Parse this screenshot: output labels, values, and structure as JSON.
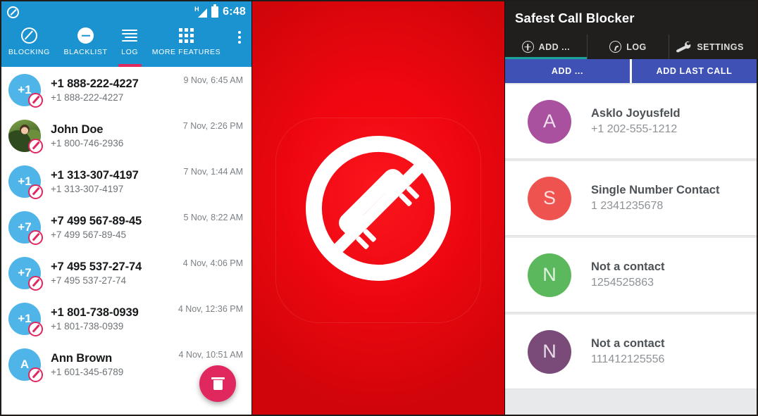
{
  "left_app": {
    "statusbar": {
      "notification_icon": "block-circle-icon",
      "network_type": "H",
      "signal_icon": "signal-bars-icon",
      "battery_icon": "battery-full-icon",
      "time": "6:48"
    },
    "accent_color": "#1b93d1",
    "indicator_color": "#e0275e",
    "tabs": [
      {
        "label": "BLOCKING",
        "icon": "block-circle-icon",
        "active": false
      },
      {
        "label": "BLACKLIST",
        "icon": "minus-circle-icon",
        "active": false
      },
      {
        "label": "LOG",
        "icon": "list-lines-icon",
        "active": true
      },
      {
        "label": "MORE FEATURES",
        "icon": "grid-dots-icon",
        "active": false
      }
    ],
    "overflow_menu": "more-vert-icon",
    "call_log": [
      {
        "title": "+1 888-222-4227",
        "subtitle": "+1 888-222-4227",
        "time": "9 Nov, 6:45 AM",
        "avatar_text": "+1",
        "avatar_type": "initials"
      },
      {
        "title": "John Doe",
        "subtitle": "+1 800-746-2936",
        "time": "7 Nov, 2:26 PM",
        "avatar_text": "",
        "avatar_type": "photo"
      },
      {
        "title": "+1 313-307-4197",
        "subtitle": "+1 313-307-4197",
        "time": "7 Nov, 1:44 AM",
        "avatar_text": "+1",
        "avatar_type": "initials"
      },
      {
        "title": "+7 499 567-89-45",
        "subtitle": "+7 499 567-89-45",
        "time": "5 Nov, 8:22 AM",
        "avatar_text": "+7",
        "avatar_type": "initials"
      },
      {
        "title": "+7 495 537-27-74",
        "subtitle": "+7 495 537-27-74",
        "time": "4 Nov, 4:06 PM",
        "avatar_text": "+7",
        "avatar_type": "initials"
      },
      {
        "title": "+1 801-738-0939",
        "subtitle": "+1 801-738-0939",
        "time": "4 Nov, 12:36 PM",
        "avatar_text": "+1",
        "avatar_type": "initials"
      },
      {
        "title": "Ann Brown",
        "subtitle": "+1 601-345-6789",
        "time": "4 Nov, 10:51 AM",
        "avatar_text": "A",
        "avatar_type": "initials"
      }
    ],
    "fab": {
      "icon": "trash-icon",
      "color": "#e0275e"
    }
  },
  "center_splash": {
    "icon": "no-phone-prohibition-icon",
    "background_color": "#ef0610",
    "icon_color": "#ffffff"
  },
  "right_app": {
    "title": "Safest Call Blocker",
    "header_color": "#201f1e",
    "accent_color": "#1aa39a",
    "button_color": "#3f51b5",
    "tabs": [
      {
        "label": "ADD ...",
        "icon": "plus-circle-icon",
        "active": true
      },
      {
        "label": "LOG",
        "icon": "clock-icon",
        "active": false
      },
      {
        "label": "SETTINGS",
        "icon": "wrench-icon",
        "active": false
      }
    ],
    "buttons": [
      {
        "label": "ADD ..."
      },
      {
        "label": "ADD LAST CALL"
      }
    ],
    "contacts": [
      {
        "name": "Asklo Joyusfeld",
        "number": "+1 202-555-1212",
        "initial": "A",
        "color": "#a css"
      },
      {
        "name": "Single Number Contact",
        "number": "1 2341235678",
        "initial": "S",
        "color": "#ee5350"
      },
      {
        "name": "Not a contact",
        "number": "1254525863",
        "initial": "N",
        "color": "#5cb униформ"
      },
      {
        "name": "Not a contact",
        "number": "111412125556",
        "initial": "N",
        "color": "#7a4a79"
      }
    ]
  }
}
